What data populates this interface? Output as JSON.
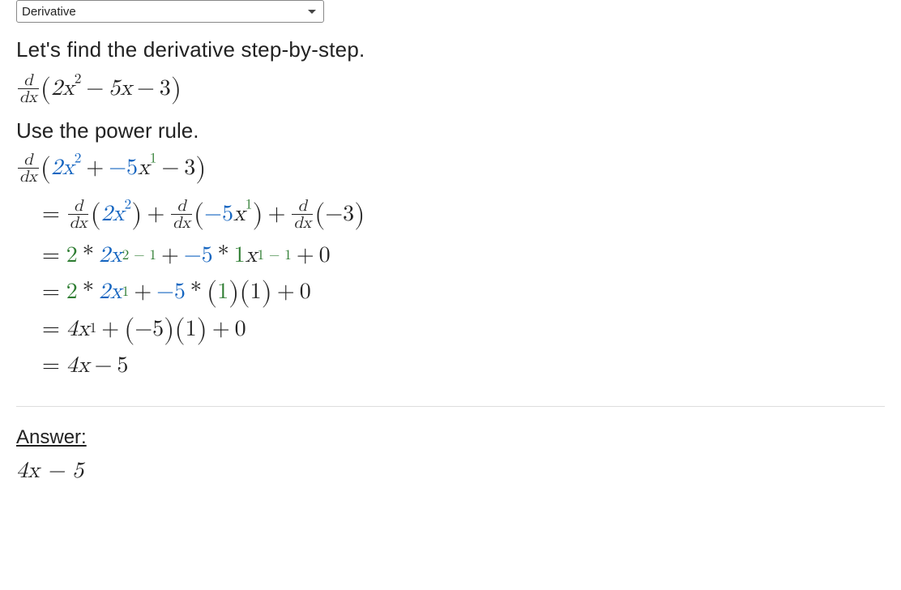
{
  "dropdown": {
    "selected": "Derivative"
  },
  "intro": "Let's find the derivative step-by-step.",
  "explain_power_rule": "Use the power rule.",
  "answer_label": "Answer:",
  "answer_value": "4x − 5",
  "sym": {
    "d": "d",
    "dx": "dx",
    "lpar": "(",
    "rpar": ")",
    "plus": "+",
    "minus": "−",
    "eq": "=",
    "star": "*",
    "zero": "0",
    "one": "1",
    "two": "2",
    "three": "3",
    "four": "4",
    "neg5": "−5",
    "2x": "2x",
    "5x": "5x",
    "1x": "1x",
    "4x": "4x",
    "x": "x",
    "neg3": "−3",
    "two_sup": "2",
    "one_sup": "1",
    "two_minus_one": "2 − 1",
    "one_minus_one": "1 − 1"
  }
}
